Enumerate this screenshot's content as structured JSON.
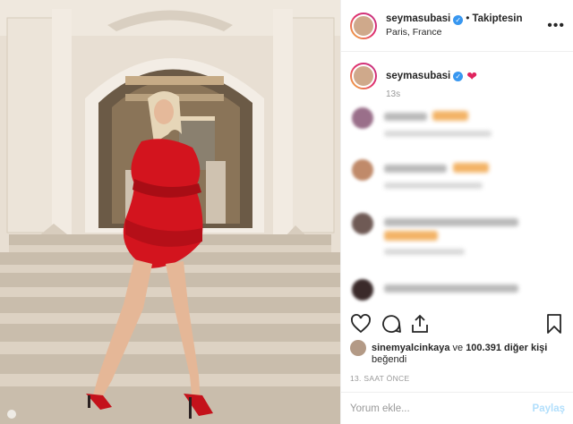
{
  "header": {
    "username": "seymasubasi",
    "verified_mark": "✓",
    "separator": "•",
    "follow_status": "Takiptesin",
    "location": "Paris, France",
    "more_label": "•••"
  },
  "caption": {
    "username": "seymasubasi",
    "verified_mark": "✓",
    "emoji": "❤",
    "time": "13s"
  },
  "comments": [
    {
      "avatar_color": "#9a6f8a"
    },
    {
      "avatar_color": "#c08a6a"
    },
    {
      "avatar_color": "#6f5a55"
    },
    {
      "avatar_color": "#3a2a2a"
    }
  ],
  "actions": {
    "like_icon": "heart-outline-icon",
    "comment_icon": "comment-bubble-icon",
    "share_icon": "share-icon",
    "save_icon": "bookmark-icon"
  },
  "likes": {
    "liker": "sinemyalcinkaya",
    "connector": " ve ",
    "count_text": "100.391 diğer kişi",
    "line2": "beğendi"
  },
  "timestamp": "13. SAAT ÖNCE",
  "comment_box": {
    "placeholder": "Yorum ekle...",
    "post_label": "Paylaş"
  },
  "colors": {
    "verified": "#3897f0",
    "dress": "#d3141e",
    "post_btn_disabled": "#b2dffc"
  }
}
